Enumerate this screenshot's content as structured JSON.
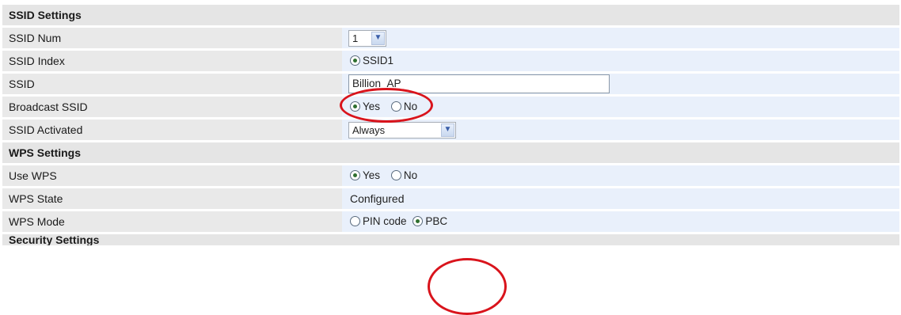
{
  "ssid_settings": {
    "title": "SSID Settings",
    "ssid_num": {
      "label": "SSID Num",
      "value": "1"
    },
    "ssid_index": {
      "label": "SSID Index",
      "option": "SSID1"
    },
    "ssid": {
      "label": "SSID",
      "value": "Billion_AP"
    },
    "broadcast": {
      "label": "Broadcast SSID",
      "yes": "Yes",
      "no": "No",
      "selected": "Yes"
    },
    "activated": {
      "label": "SSID Activated",
      "value": "Always"
    }
  },
  "wps_settings": {
    "title": "WPS Settings",
    "use_wps": {
      "label": "Use WPS",
      "yes": "Yes",
      "no": "No",
      "selected": "Yes"
    },
    "state": {
      "label": "WPS State",
      "value": "Configured"
    },
    "mode": {
      "label": "WPS Mode",
      "pin": "PIN code",
      "pbc": "PBC",
      "selected": "PBC"
    }
  },
  "security_settings": {
    "title": "Security Settings"
  },
  "colors": {
    "highlight": "#d9141c",
    "label_bg": "#e9e9e9",
    "value_bg": "#e9f0fb",
    "radio_dot": "#2f6f2f"
  }
}
